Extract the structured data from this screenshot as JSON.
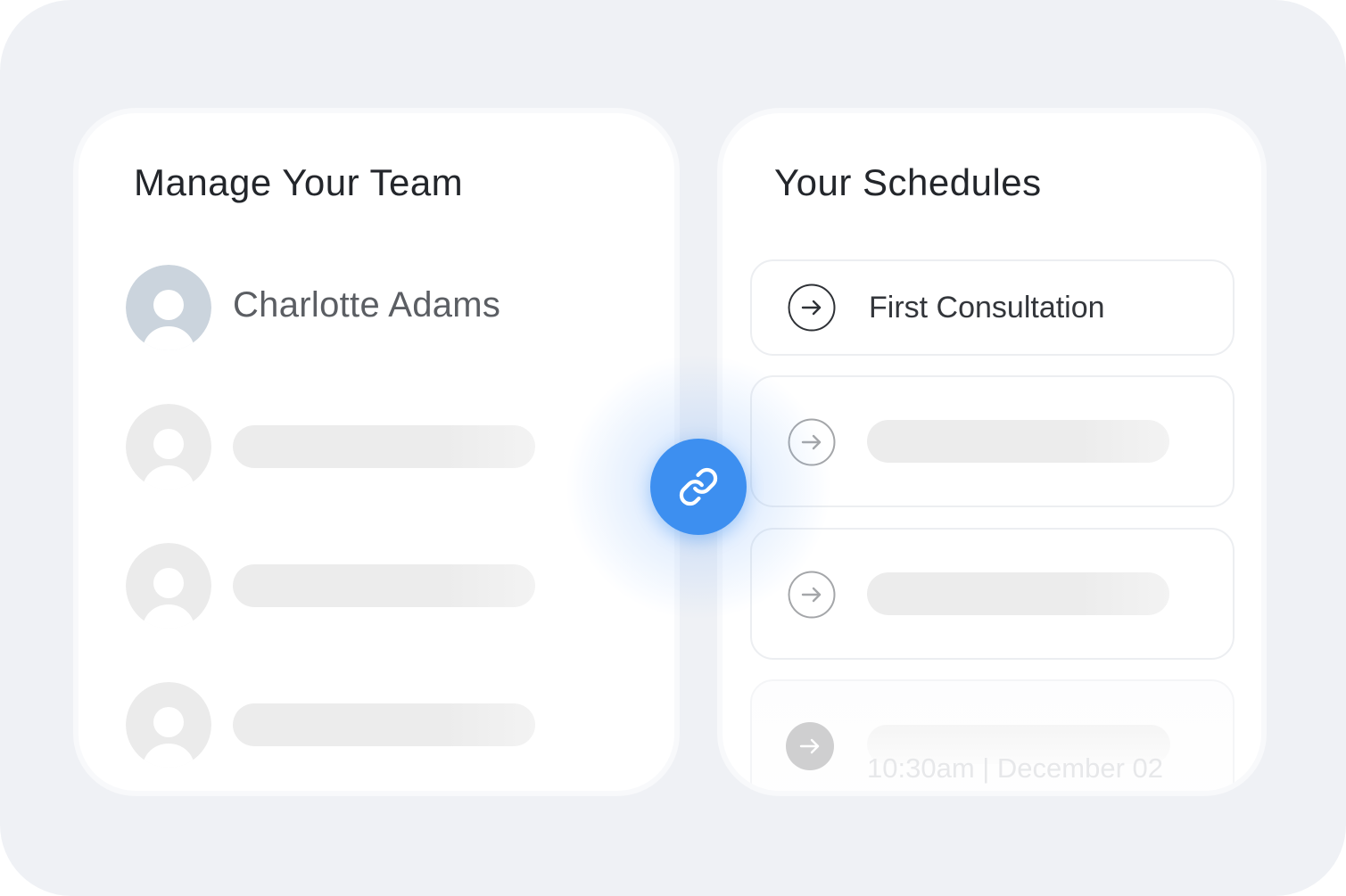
{
  "team_card": {
    "title": "Manage Your Team",
    "members": [
      {
        "name": "Charlotte Adams",
        "avatar_color": "#cbd4dd"
      }
    ]
  },
  "schedule_card": {
    "title": "Your Schedules",
    "items": [
      {
        "label": "First Consultation"
      }
    ],
    "faded_item": {
      "time": "10:30am | December 02"
    }
  },
  "link_button": {
    "icon": "link-icon",
    "color": "#3d8ff0"
  },
  "colors": {
    "background": "#eff1f5",
    "placeholder_avatar": "#ebebeb",
    "skeleton": "#ececec",
    "accent": "#3d8ff0"
  }
}
